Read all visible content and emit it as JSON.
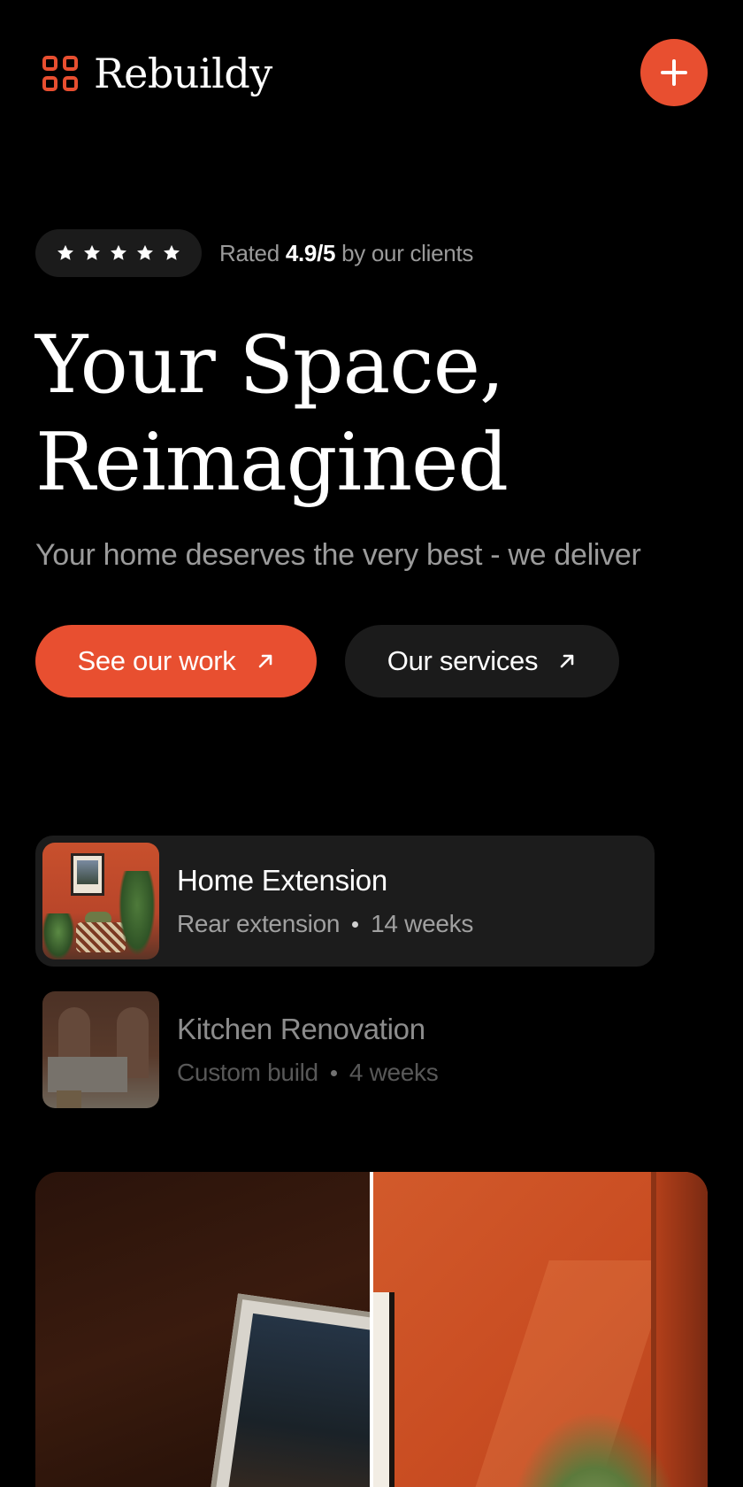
{
  "brand": {
    "name": "Rebuildy",
    "accent": "#e84f30"
  },
  "header": {
    "add_icon": "plus-icon"
  },
  "rating": {
    "stars": 5,
    "prefix": "Rated",
    "score": "4.9/5",
    "suffix": "by our clients"
  },
  "hero": {
    "title_line1": "Your Space,",
    "title_line2": "Reimagined",
    "subtitle": "Your home deserves the very best - we deliver"
  },
  "buttons": {
    "primary_label": "See our work",
    "secondary_label": "Our services",
    "arrow_icon": "arrow-up-right-icon"
  },
  "projects": [
    {
      "title": "Home Extension",
      "type": "Rear extension",
      "duration": "14 weeks"
    },
    {
      "title": "Kitchen Renovation",
      "type": "Custom build",
      "duration": "4 weeks"
    }
  ]
}
